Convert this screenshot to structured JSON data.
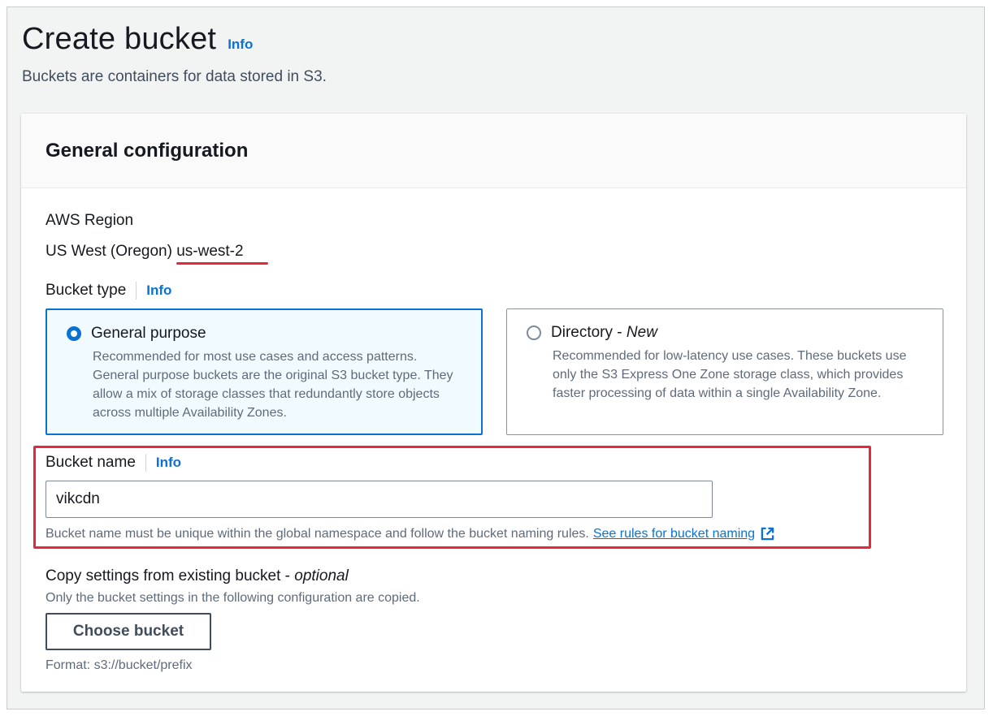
{
  "header": {
    "title": "Create bucket",
    "info_label": "Info",
    "description": "Buckets are containers for data stored in S3."
  },
  "panel": {
    "title": "General configuration"
  },
  "region": {
    "label": "AWS Region",
    "name": "US West (Oregon)",
    "code": "us-west-2"
  },
  "bucket_type": {
    "label": "Bucket type",
    "info_label": "Info",
    "options": [
      {
        "title": "General purpose",
        "title_suffix": "",
        "selected": true,
        "description": "Recommended for most use cases and access patterns. General purpose buckets are the original S3 bucket type. They allow a mix of storage classes that redundantly store objects across multiple Availability Zones."
      },
      {
        "title": "Directory - ",
        "title_suffix": "New",
        "selected": false,
        "description": "Recommended for low-latency use cases. These buckets use only the S3 Express One Zone storage class, which provides faster processing of data within a single Availability Zone."
      }
    ]
  },
  "bucket_name": {
    "label": "Bucket name",
    "info_label": "Info",
    "value": "vikcdn",
    "constraint": "Bucket name must be unique within the global namespace and follow the bucket naming rules.",
    "rules_link": "See rules for bucket naming"
  },
  "copy_settings": {
    "label": "Copy settings from existing bucket - ",
    "label_suffix": "optional",
    "description": "Only the bucket settings in the following configuration are copied.",
    "button_label": "Choose bucket",
    "format_hint": "Format: s3://bucket/prefix"
  },
  "colors": {
    "accent": "#0972d3",
    "annotation_red": "#e8283a"
  },
  "icons": {
    "external_link": "external-link-icon",
    "radio_selected": "radio-selected-icon",
    "radio_unselected": "radio-unselected-icon"
  }
}
